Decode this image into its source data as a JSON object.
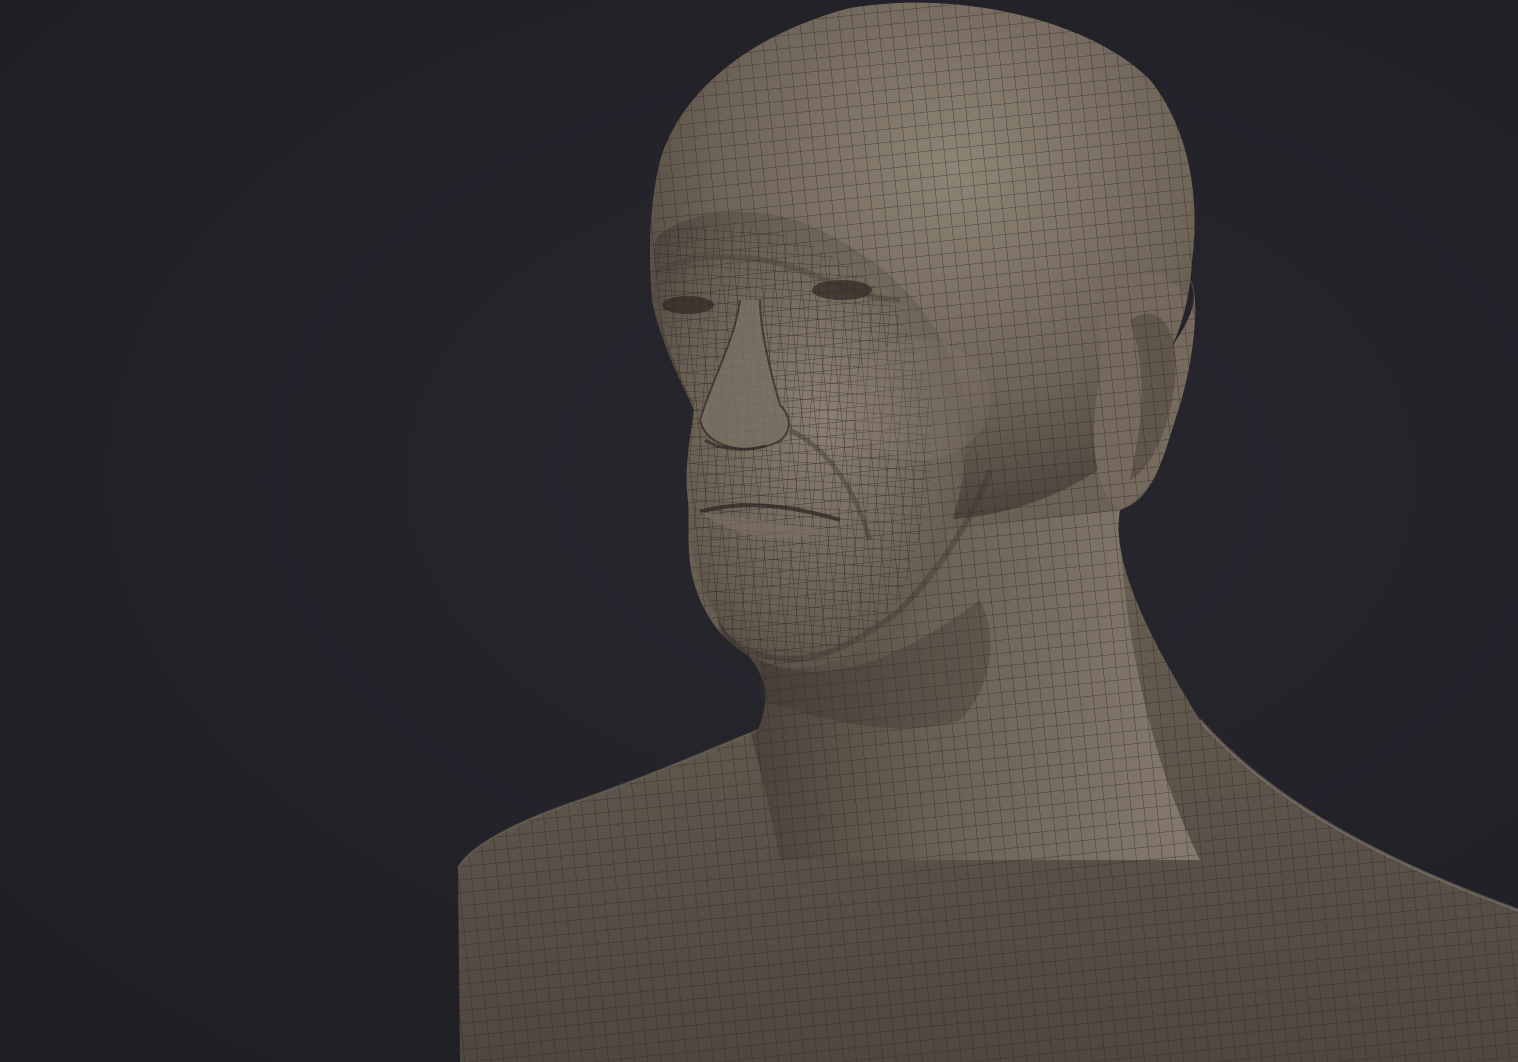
{
  "scene": {
    "subject": "sculpted-head-bust-wireframe",
    "colors": {
      "background": "#232229",
      "clay": "#6f6458",
      "clay_highlight": "#8c8173",
      "clay_shadow": "#3d3731",
      "wire": "#2b2621"
    }
  }
}
